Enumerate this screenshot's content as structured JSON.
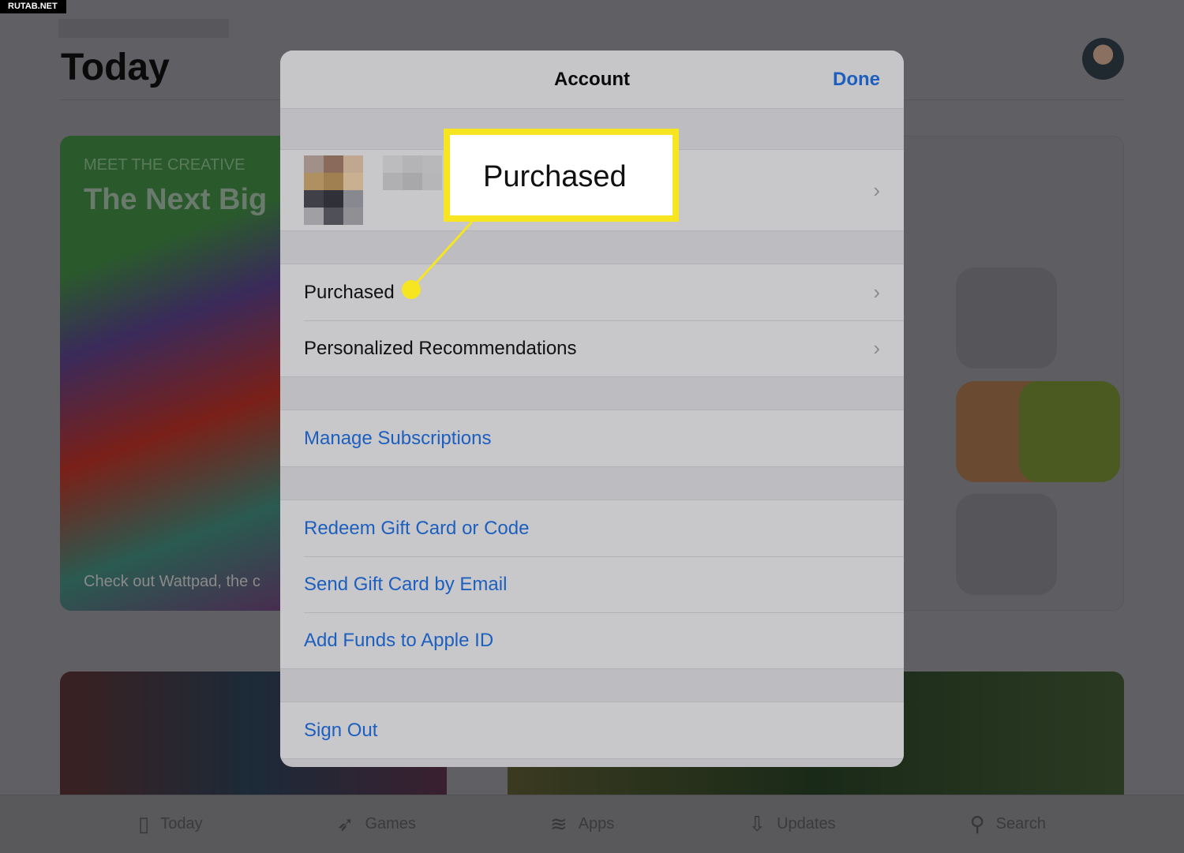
{
  "watermark": "RUTAB.NET",
  "page": {
    "title": "Today"
  },
  "featured": {
    "kicker": "MEET THE CREATIVE",
    "headline": "The Next Big",
    "footer": "Check out Wattpad, the c"
  },
  "tabbar": [
    {
      "label": "Today",
      "icon": "today-icon"
    },
    {
      "label": "Games",
      "icon": "rocket-icon"
    },
    {
      "label": "Apps",
      "icon": "layers-icon"
    },
    {
      "label": "Updates",
      "icon": "download-icon"
    },
    {
      "label": "Search",
      "icon": "search-icon"
    }
  ],
  "modal": {
    "title": "Account",
    "done": "Done",
    "items": {
      "purchased": "Purchased",
      "recommendations": "Personalized Recommendations",
      "subscriptions": "Manage Subscriptions",
      "redeem": "Redeem Gift Card or Code",
      "send_gift": "Send Gift Card by Email",
      "add_funds": "Add Funds to Apple ID",
      "sign_out": "Sign Out"
    }
  },
  "callout": {
    "label": "Purchased",
    "color": "#f7e521"
  },
  "colors": {
    "link": "#1d5fbf",
    "highlight": "#f7e521"
  }
}
